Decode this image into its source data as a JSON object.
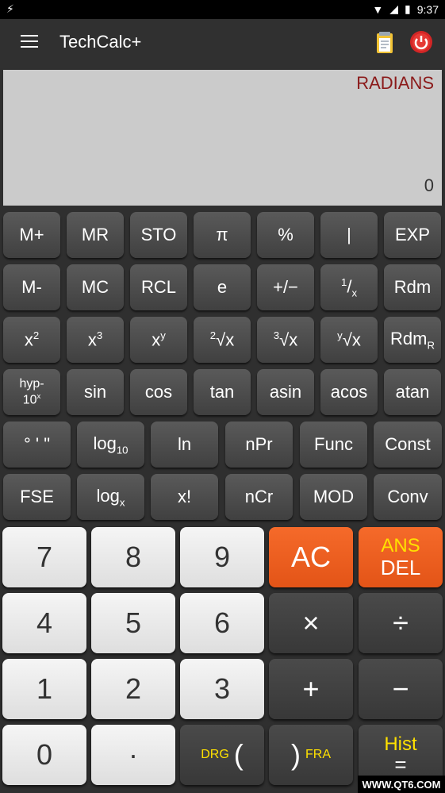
{
  "status": {
    "time": "9:37"
  },
  "app": {
    "title": "TechCalc+"
  },
  "display": {
    "mode": "RADIANS",
    "value": "0"
  },
  "rows": {
    "r1": [
      "M+",
      "MR",
      "STO",
      "π",
      "%",
      "|",
      "EXP"
    ],
    "r2": [
      "M-",
      "MC",
      "RCL",
      "e",
      "+/−",
      "Rdm"
    ],
    "r3": [
      "Rdm"
    ],
    "r4": [
      "sin",
      "cos",
      "tan",
      "asin",
      "acos",
      "atan"
    ],
    "r5": [
      "° ' \"",
      "ln",
      "nPr",
      "Func",
      "Const"
    ],
    "r6": [
      "FSE",
      "x!",
      "nCr",
      "MOD",
      "Conv"
    ]
  },
  "keys": {
    "hyp_top": "hyp-",
    "hyp_bot": "10",
    "log10_main": "log",
    "log10_sub": "10",
    "logx_main": "log",
    "logx_sub": "x",
    "rdm_r": "R",
    "num_7": "7",
    "num_8": "8",
    "num_9": "9",
    "num_4": "4",
    "num_5": "5",
    "num_6": "6",
    "num_1": "1",
    "num_2": "2",
    "num_3": "3",
    "num_0": "0",
    "dot": "·",
    "ac": "AC",
    "ans": "ANS",
    "del": "DEL",
    "mul": "×",
    "div": "÷",
    "plus": "+",
    "minus": "−",
    "drg": "DRG",
    "lparen": "(",
    "rparen": ")",
    "fra": "FRA",
    "hist": "Hist",
    "eq": "="
  },
  "watermark": "WWW.QT6.COM"
}
